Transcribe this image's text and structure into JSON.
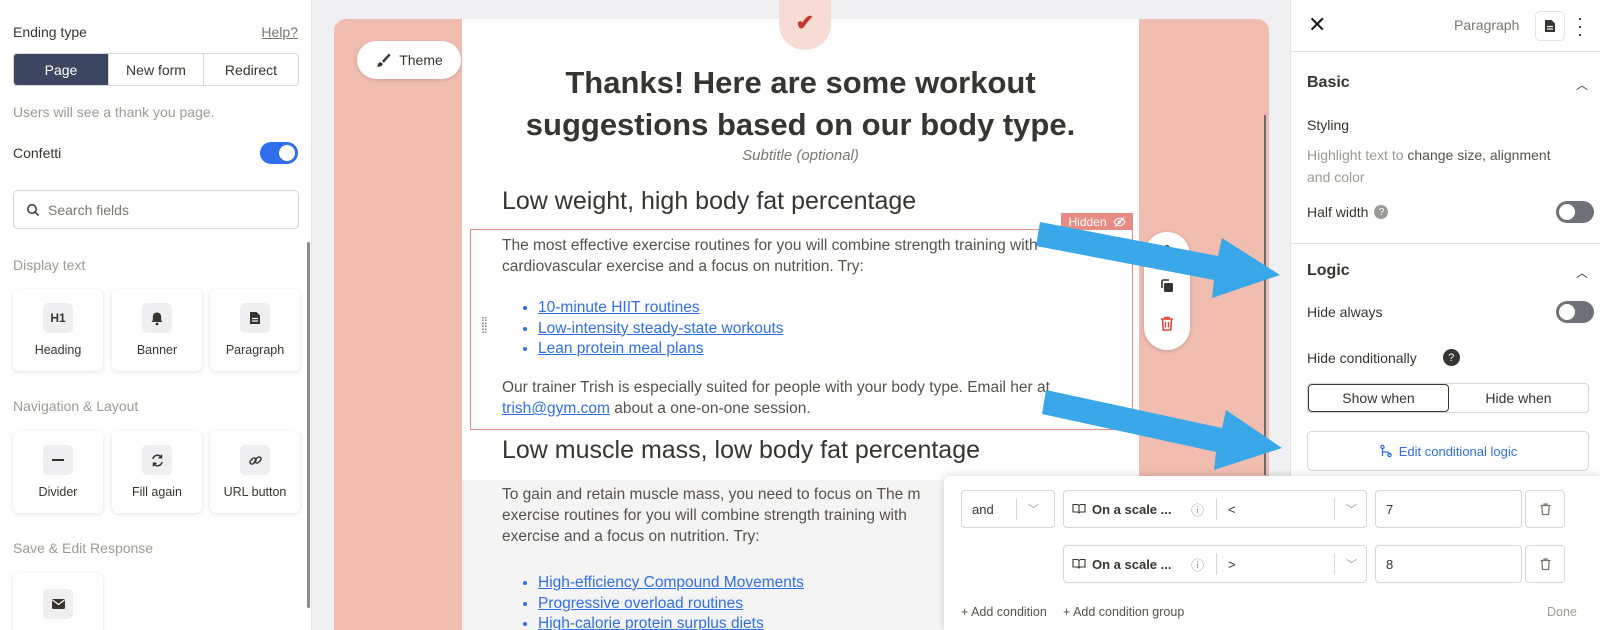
{
  "left_panel": {
    "ending_type_label": "Ending type",
    "help_link": "Help?",
    "ending_tabs": [
      "Page",
      "New form",
      "Redirect"
    ],
    "active_ending_tab": "Page",
    "hint": "Users will see a thank you page.",
    "confetti_label": "Confetti",
    "confetti_on": true,
    "search_placeholder": "Search fields",
    "sections": {
      "display_text": "Display text",
      "navigation_layout": "Navigation & Layout",
      "save_edit": "Save & Edit Response"
    },
    "display_tiles": [
      {
        "label": "Heading",
        "icon": "heading-icon",
        "glyph": "H1"
      },
      {
        "label": "Banner",
        "icon": "bell-icon"
      },
      {
        "label": "Paragraph",
        "icon": "document-icon"
      }
    ],
    "nav_tiles": [
      {
        "label": "Divider",
        "icon": "divider-icon"
      },
      {
        "label": "Fill again",
        "icon": "refresh-icon"
      },
      {
        "label": "URL button",
        "icon": "link-icon"
      }
    ],
    "save_tiles": [
      {
        "icon": "envelope-icon"
      }
    ]
  },
  "canvas": {
    "theme_button": "Theme",
    "title_line1": "Thanks! Here are some workout",
    "title_line2": "suggestions based on our body type.",
    "subtitle": "Subtitle (optional)",
    "hidden_badge": "Hidden",
    "section1": {
      "heading": "Low weight, high body fat percentage",
      "intro_line1": "The most effective exercise routines for you will combine strength training with",
      "intro_line2": "cardiovascular exercise and a focus on nutrition. Try:",
      "links": [
        "10-minute HIIT routines",
        "Low-intensity steady-state workouts",
        "Lean protein meal plans"
      ],
      "outro_line1": "Our trainer Trish is especially suited for people with your body type. Email her at",
      "email": "trish@gym.com",
      "outro_line2": " about a one-on-one session."
    },
    "section2": {
      "heading": "Low muscle mass, low body fat percentage",
      "intro_line1": "To gain and retain muscle mass, you need to focus on The m",
      "intro_line2": "exercise routines for you will combine strength training with",
      "intro_line3": "exercise and a focus on nutrition. Try:",
      "links": [
        "High-efficiency Compound Movements",
        "Progressive overload routines",
        "High-calorie protein surplus diets"
      ]
    }
  },
  "right_panel": {
    "block_type": "Paragraph",
    "basic_title": "Basic",
    "styling_label": "Styling",
    "styling_hint_pre": "Highlight text to ",
    "styling_hint_bold": "change size, alignment",
    "styling_hint_post": "and color",
    "half_width_label": "Half width",
    "half_width_on": false,
    "logic_title": "Logic",
    "hide_always_label": "Hide always",
    "hide_always_on": false,
    "hide_conditionally_label": "Hide conditionally",
    "condition_tabs": [
      "Show when",
      "Hide when"
    ],
    "active_condition_tab": "Show when",
    "edit_logic_button": "Edit conditional logic"
  },
  "logic_popup": {
    "rows": [
      {
        "connector": "and",
        "field": "On a scale ...",
        "operator": "<",
        "value": "7"
      },
      {
        "connector": "",
        "field": "On a scale ...",
        "operator": ">",
        "value": "8"
      }
    ],
    "add_condition": "+ Add condition",
    "add_group": "+ Add condition group",
    "done": "Done"
  },
  "colors": {
    "accent_blue": "#2f6fed",
    "canvas_salmon": "#f1bdb1",
    "arrow_blue": "#3aa8e8",
    "danger_red": "#e0453a"
  }
}
